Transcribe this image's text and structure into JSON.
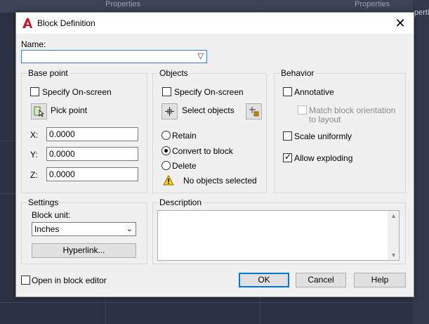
{
  "background": {
    "top_label_1": "Properties",
    "top_label_2": "Properties",
    "right_label": "pertie"
  },
  "dialog": {
    "title": "Block Definition",
    "close_symbol": "✕"
  },
  "name": {
    "label": "Name:",
    "value": ""
  },
  "base_point": {
    "title": "Base point",
    "specify_on_screen": "Specify On-screen",
    "specify_checked": false,
    "pick_point": "Pick point",
    "x_label": "X:",
    "x_value": "0.0000",
    "y_label": "Y:",
    "y_value": "0.0000",
    "z_label": "Z:",
    "z_value": "0.0000"
  },
  "objects": {
    "title": "Objects",
    "specify_on_screen": "Specify On-screen",
    "specify_checked": false,
    "select_objects": "Select objects",
    "retain": "Retain",
    "convert_to_block": "Convert to block",
    "delete": "Delete",
    "selected_option": "convert_to_block",
    "status": "No objects selected"
  },
  "behavior": {
    "title": "Behavior",
    "annotative": "Annotative",
    "annotative_checked": false,
    "match_orientation_line1": "Match block orientation",
    "match_orientation_line2": "to layout",
    "match_orientation_checked": false,
    "scale_uniformly": "Scale uniformly",
    "scale_uniformly_checked": false,
    "allow_exploding": "Allow exploding",
    "allow_exploding_checked": true
  },
  "settings": {
    "title": "Settings",
    "block_unit_label": "Block unit:",
    "block_unit_value": "Inches",
    "hyperlink_button": "Hyperlink..."
  },
  "description": {
    "title": "Description",
    "value": ""
  },
  "footer": {
    "open_in_block_editor": "Open in block editor",
    "open_in_block_editor_checked": false,
    "ok": "OK",
    "cancel": "Cancel",
    "help": "Help"
  },
  "colors": {
    "accent": "#0078d7",
    "autocad_red": "#c8102e",
    "warning_yellow": "#f5d100"
  }
}
